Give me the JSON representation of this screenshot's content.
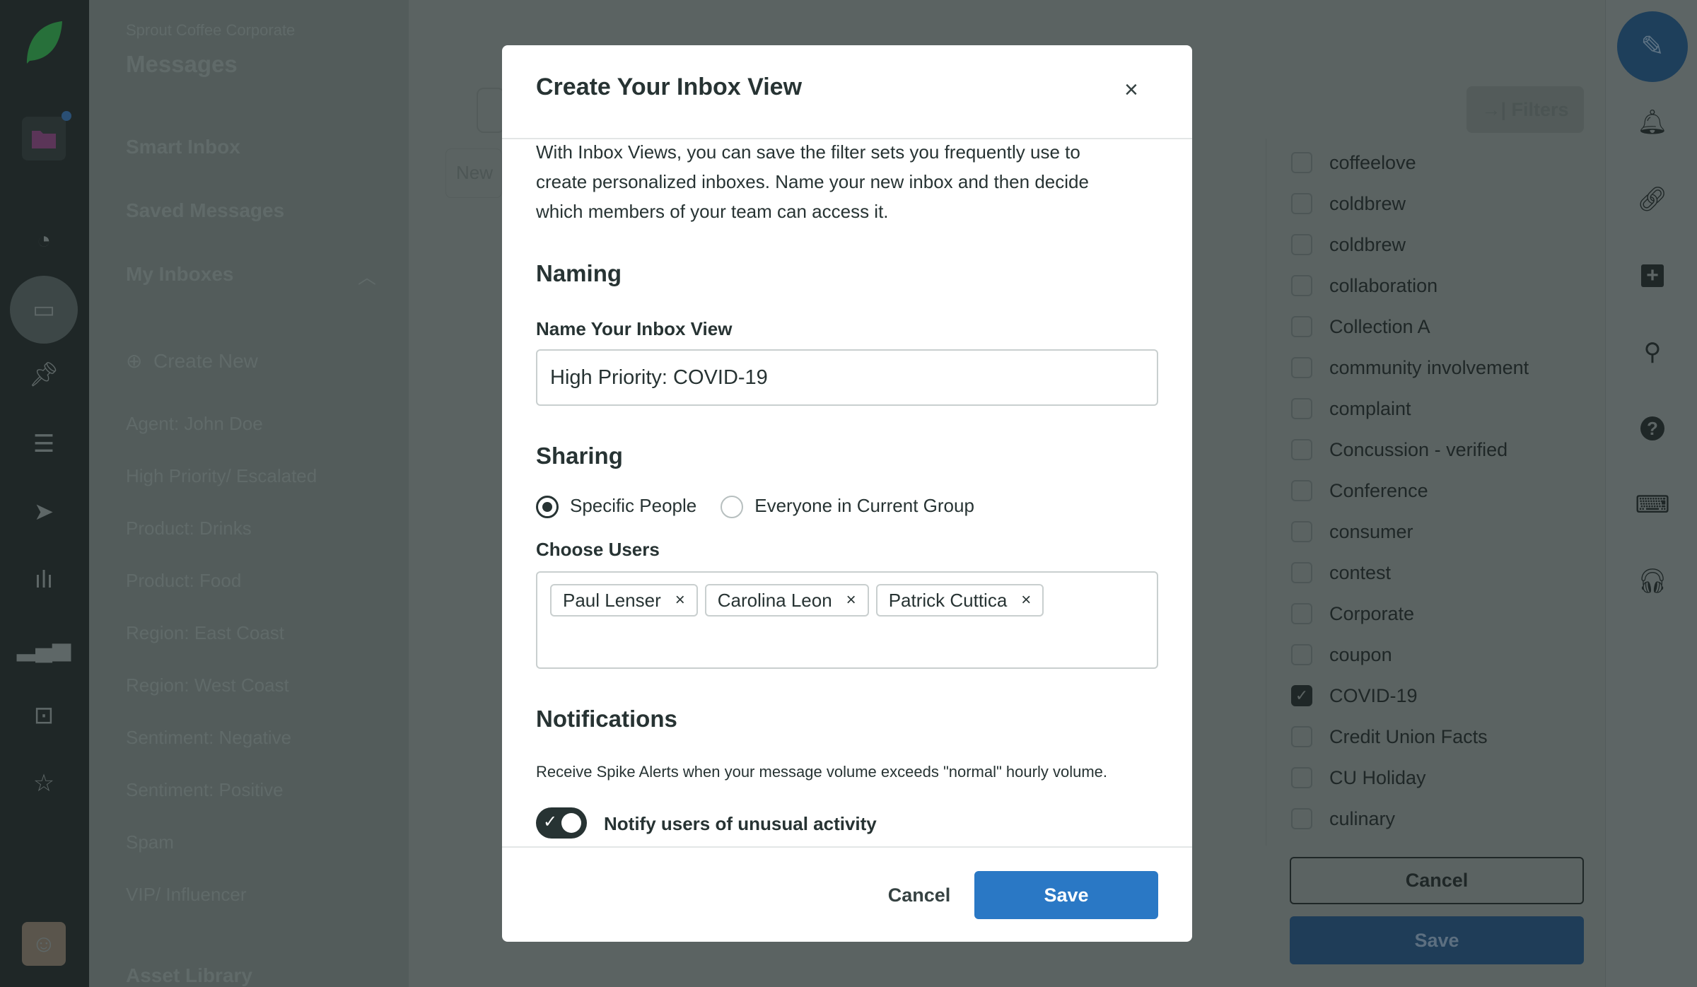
{
  "leftnav": {
    "icons": [
      "sprout-logo-icon",
      "folder-icon",
      "gauge-icon",
      "inbox-icon",
      "pin-icon",
      "list-icon",
      "send-icon",
      "listening-icon",
      "reports-icon",
      "bot-icon",
      "star-icon",
      "user-avatar"
    ]
  },
  "sidebar": {
    "org": "Sprout Coffee Corporate",
    "title": "Messages",
    "smart_inbox": "Smart Inbox",
    "saved_messages": "Saved Messages",
    "my_inboxes": "My Inboxes",
    "create_new": "Create New",
    "inboxes": [
      "Agent: John Doe",
      "High Priority/ Escalated",
      "Product: Drinks",
      "Product: Food",
      "Region: East Coast",
      "Region: West Coast",
      "Sentiment: Negative",
      "Sentiment: Positive",
      "Spam",
      "VIP/ Influencer"
    ],
    "asset_library": "Asset Library"
  },
  "main": {
    "new_label": "New"
  },
  "filters": {
    "button": "Filters",
    "tags": [
      {
        "label": "coffeelove",
        "checked": false
      },
      {
        "label": "coldbrew",
        "checked": false
      },
      {
        "label": "coldbrew",
        "checked": false
      },
      {
        "label": "collaboration",
        "checked": false
      },
      {
        "label": "Collection A",
        "checked": false
      },
      {
        "label": "community involvement",
        "checked": false
      },
      {
        "label": "complaint",
        "checked": false
      },
      {
        "label": "Concussion - verified",
        "checked": false
      },
      {
        "label": "Conference",
        "checked": false
      },
      {
        "label": "consumer",
        "checked": false
      },
      {
        "label": "contest",
        "checked": false
      },
      {
        "label": "Corporate",
        "checked": false
      },
      {
        "label": "coupon",
        "checked": false
      },
      {
        "label": "COVID-19",
        "checked": true
      },
      {
        "label": "Credit Union Facts",
        "checked": false
      },
      {
        "label": "CU Holiday",
        "checked": false
      },
      {
        "label": "culinary",
        "checked": false
      }
    ],
    "cancel": "Cancel",
    "save": "Save"
  },
  "modal": {
    "title": "Create Your Inbox View",
    "intro": "With Inbox Views, you can save the filter sets you frequently use to create personalized inboxes. Name your new inbox and then decide which members of your team can access it.",
    "naming_heading": "Naming",
    "name_label": "Name Your Inbox View",
    "name_value": "High Priority: COVID-19",
    "sharing_heading": "Sharing",
    "sharing_options": [
      {
        "label": "Specific People",
        "selected": true
      },
      {
        "label": "Everyone in Current Group",
        "selected": false
      }
    ],
    "choose_users_label": "Choose Users",
    "users": [
      "Paul Lenser",
      "Carolina Leon",
      "Patrick Cuttica"
    ],
    "notifications_heading": "Notifications",
    "spike_text": "Receive Spike Alerts when your message volume exceeds \"normal\" hourly volume.",
    "notify_label": "Notify users of unusual activity",
    "notify_on": true,
    "cancel": "Cancel",
    "save": "Save"
  },
  "colors": {
    "primary": "#2a78c5",
    "text": "#273333"
  }
}
